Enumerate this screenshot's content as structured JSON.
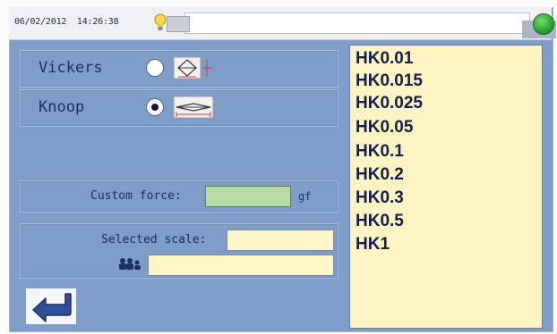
{
  "status_bar": {
    "date": "06/02/2012",
    "time": "14:26:38",
    "led_color": "#2fb336",
    "icons": [
      "bulb-icon",
      "status-led"
    ]
  },
  "methods": [
    {
      "label": "Vickers",
      "selected": false,
      "icon": "vickers-indenter-icon"
    },
    {
      "label": "Knoop",
      "selected": true,
      "icon": "knoop-indenter-icon"
    }
  ],
  "custom_force": {
    "label": "Custom force:",
    "value": "",
    "unit": "gf"
  },
  "selected_scale": {
    "label": "Selected scale:",
    "value": "",
    "secondary_value": "",
    "icon": "people-icon"
  },
  "back_button": {
    "icon": "back-arrow-icon"
  },
  "scale_list": {
    "items": [
      "HK0.01",
      "HK0.015",
      "HK0.025",
      "HK0.05",
      "HK0.1",
      "HK0.2",
      "HK0.3",
      "HK0.5",
      "HK1"
    ]
  },
  "colors": {
    "panel": "#7e9ec9",
    "list_bg": "#fcf3c2",
    "force_input": "#b7dca9",
    "text": "#1c2f63"
  }
}
